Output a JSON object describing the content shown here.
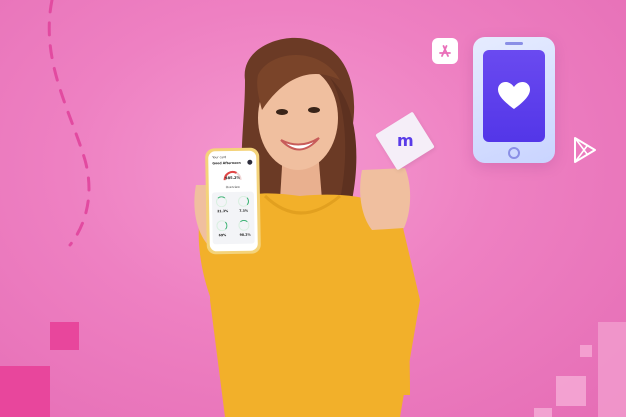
{
  "colors": {
    "background": "#ee80c2",
    "accent_square": "#e8469c",
    "phone_screen": "#5a3ce8",
    "shirt": "#f2b02a",
    "hair": "#6b3a25"
  },
  "icons": {
    "app_store": "app-store-icon",
    "google_play": "google-play-icon",
    "heart": "heart-icon",
    "card_logo": "brand-m-logo"
  },
  "phone_app": {
    "status": "Your card",
    "title": "Good Afternoon",
    "main_value": "$85.2%",
    "section": "Overview",
    "metrics": [
      "21.3%",
      "7.3%",
      "69%",
      "98.2%"
    ]
  },
  "card": {
    "logo_text": "m"
  }
}
